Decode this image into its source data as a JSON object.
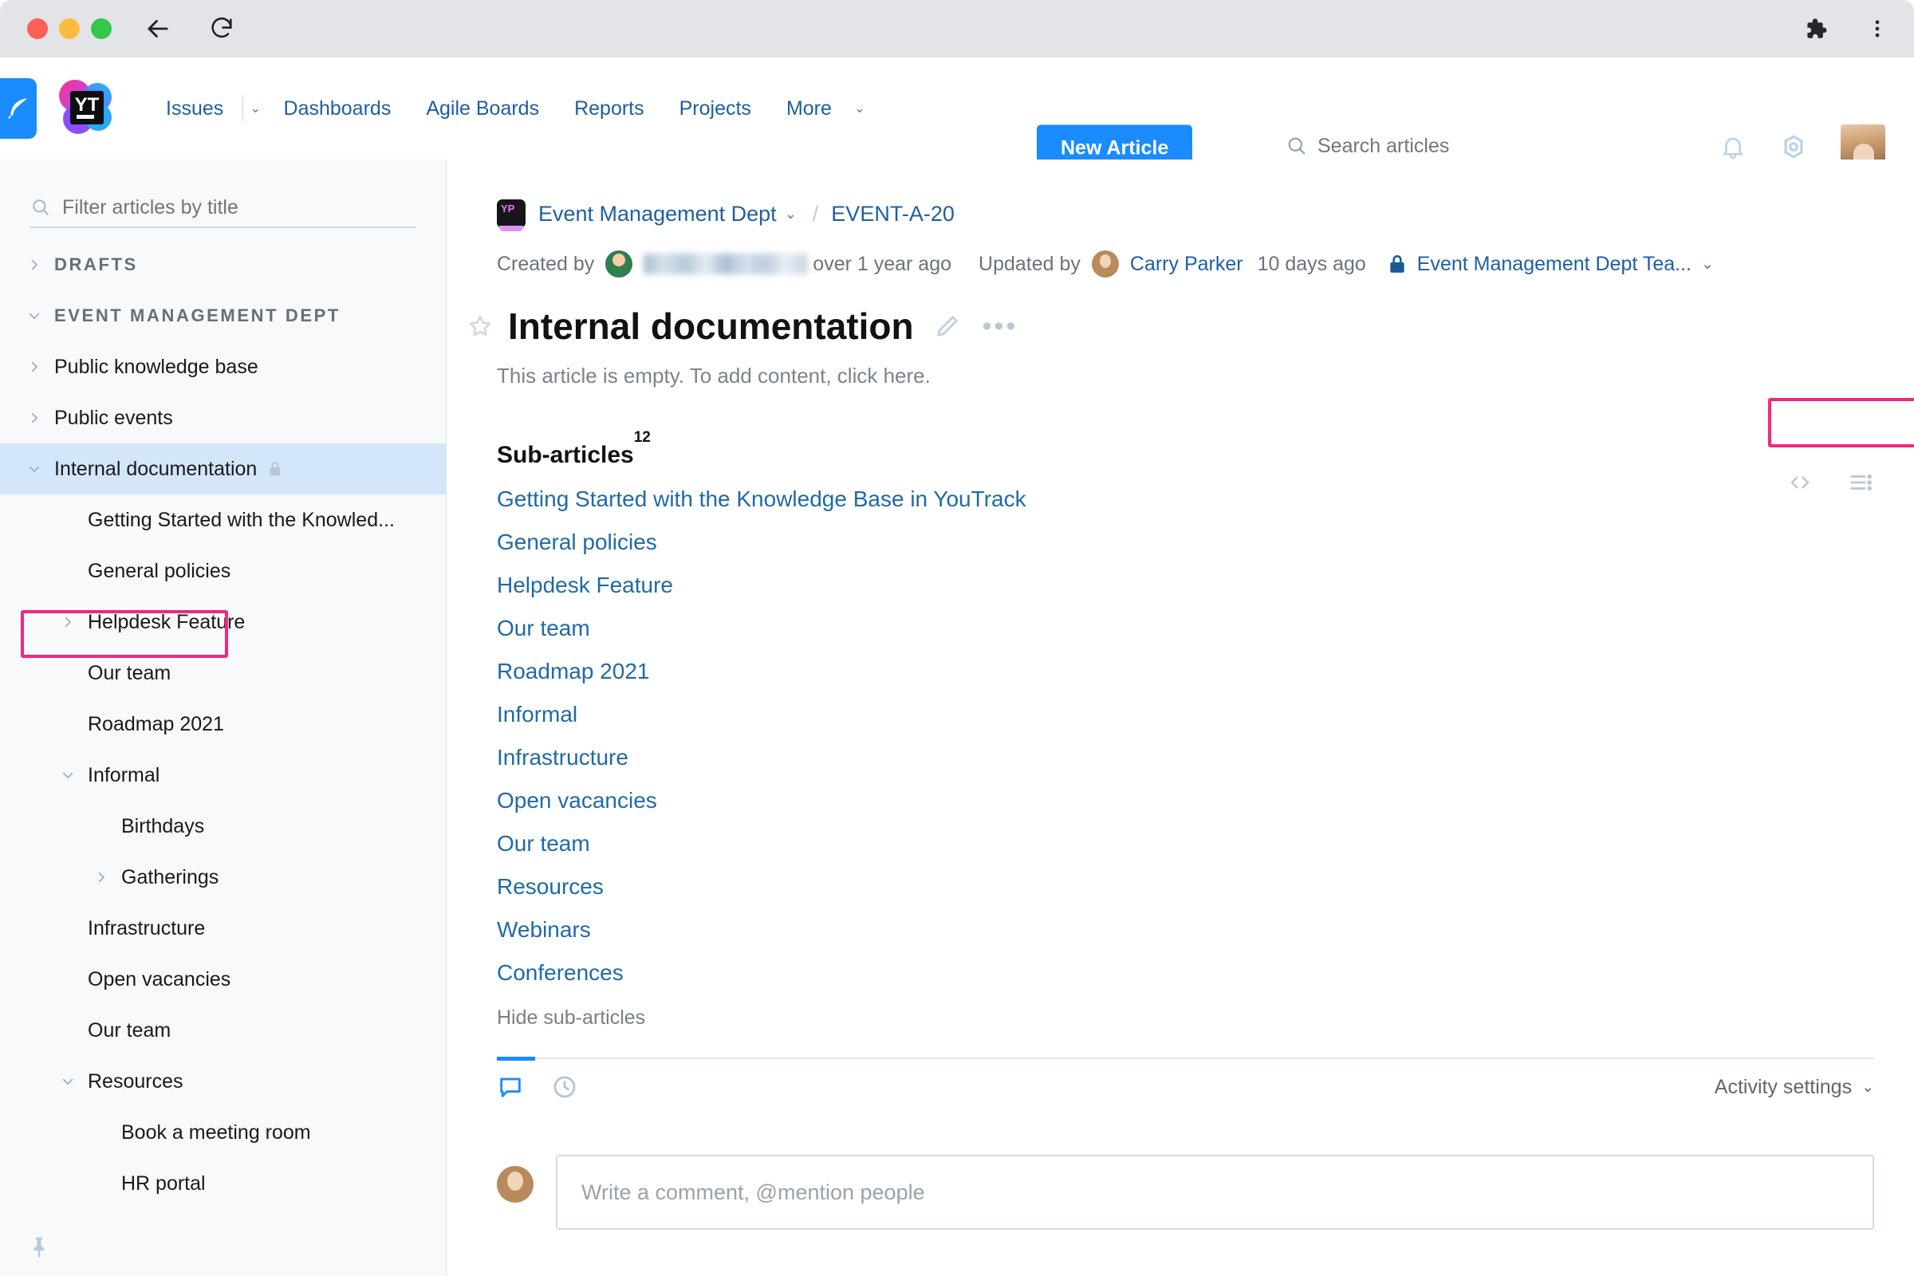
{
  "browser": {
    "icons": [
      "extensions-puzzle-icon",
      "browser-menu-icon"
    ],
    "back_label": "←",
    "reload_label": "⟳"
  },
  "header": {
    "logo_text": "YT",
    "nav": [
      {
        "label": "Issues",
        "has_caret": true
      },
      {
        "label": "Dashboards",
        "has_caret": false
      },
      {
        "label": "Agile Boards",
        "has_caret": false
      },
      {
        "label": "Reports",
        "has_caret": false
      },
      {
        "label": "Projects",
        "has_caret": false
      },
      {
        "label": "More",
        "has_caret": true
      }
    ],
    "new_article_label": "New Article",
    "search_placeholder": "Search articles",
    "search_value": ""
  },
  "sidebar": {
    "filter_placeholder": "Filter articles by title",
    "filter_value": "",
    "items": [
      {
        "label": "DRAFTS",
        "type": "section",
        "twisty": "collapsed",
        "indent": 0
      },
      {
        "label": "EVENT MANAGEMENT DEPT",
        "type": "section",
        "twisty": "expanded",
        "indent": 0
      },
      {
        "label": "Public knowledge base",
        "type": "item",
        "twisty": "collapsed",
        "indent": 0
      },
      {
        "label": "Public events",
        "type": "item",
        "twisty": "collapsed",
        "indent": 0
      },
      {
        "label": "Internal documentation",
        "type": "item",
        "twisty": "expanded",
        "indent": 0,
        "selected": true,
        "lock": true
      },
      {
        "label": "Getting Started with the Knowled...",
        "type": "item",
        "twisty": "none",
        "indent": 1
      },
      {
        "label": "General policies",
        "type": "item",
        "twisty": "none",
        "indent": 1
      },
      {
        "label": "Helpdesk Feature",
        "type": "item",
        "twisty": "collapsed",
        "indent": 1
      },
      {
        "label": "Our team",
        "type": "item",
        "twisty": "none",
        "indent": 1
      },
      {
        "label": "Roadmap 2021",
        "type": "item",
        "twisty": "none",
        "indent": 1
      },
      {
        "label": "Informal",
        "type": "item",
        "twisty": "expanded",
        "indent": 1
      },
      {
        "label": "Birthdays",
        "type": "item",
        "twisty": "none",
        "indent": 2
      },
      {
        "label": "Gatherings",
        "type": "item",
        "twisty": "collapsed",
        "indent": 2
      },
      {
        "label": "Infrastructure",
        "type": "item",
        "twisty": "none",
        "indent": 1
      },
      {
        "label": "Open vacancies",
        "type": "item",
        "twisty": "none",
        "indent": 1
      },
      {
        "label": "Our team",
        "type": "item",
        "twisty": "none",
        "indent": 1
      },
      {
        "label": "Resources",
        "type": "item",
        "twisty": "expanded",
        "indent": 1
      },
      {
        "label": "Book a meeting room",
        "type": "item",
        "twisty": "none",
        "indent": 2
      },
      {
        "label": "HR portal",
        "type": "item",
        "twisty": "none",
        "indent": 2
      }
    ]
  },
  "article": {
    "breadcrumb_project": "Event Management Dept",
    "breadcrumb_separator": "/",
    "breadcrumb_id": "EVENT-A-20",
    "created_by_label": "Created by",
    "created_by_name": "",
    "created_ago": "over 1 year ago",
    "updated_by_label": "Updated by",
    "updated_by_name": "Carry Parker",
    "updated_ago": "10 days ago",
    "visibility_label": "Event Management Dept Tea...",
    "title": "Internal documentation",
    "empty_note": "This article is empty. To add content, click here.",
    "subarticles_label": "Sub-articles",
    "subarticles_count": "12",
    "subarticles": [
      "Getting Started with the Knowledge Base in YouTrack",
      "General policies",
      "Helpdesk Feature",
      "Our team",
      "Roadmap 2021",
      "Informal",
      "Infrastructure",
      "Open vacancies",
      "Our team",
      "Resources",
      "Webinars",
      "Conferences"
    ],
    "hide_subarticles_label": "Hide sub-articles"
  },
  "activity": {
    "settings_label": "Activity settings",
    "comment_placeholder": "Write a comment, @mention people"
  },
  "colors": {
    "accent_blue": "#1a8cff",
    "link_blue": "#1f5fa0",
    "highlight_pink": "#f0297e",
    "selected_row": "#d4e6fa",
    "sidebar_bg": "#f7f9fb"
  }
}
